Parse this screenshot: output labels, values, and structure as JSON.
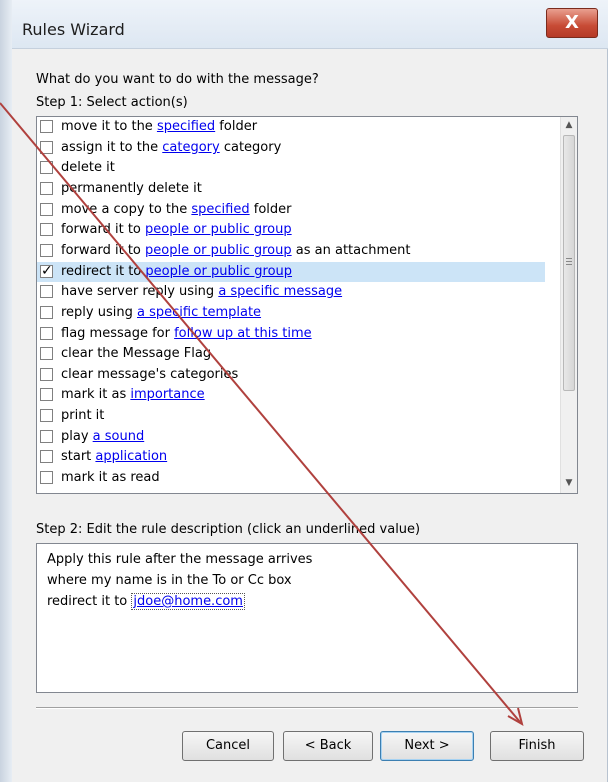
{
  "window": {
    "title": "Rules Wizard",
    "close_label": "X"
  },
  "prompt": "What do you want to do with the message?",
  "step1_label": "Step 1: Select action(s)",
  "actions": [
    {
      "checked": false,
      "parts": [
        {
          "t": "move it to the "
        },
        {
          "t": "specified",
          "link": true
        },
        {
          "t": " folder"
        }
      ]
    },
    {
      "checked": false,
      "parts": [
        {
          "t": "assign it to the "
        },
        {
          "t": "category",
          "link": true
        },
        {
          "t": " category"
        }
      ]
    },
    {
      "checked": false,
      "parts": [
        {
          "t": "delete it"
        }
      ]
    },
    {
      "checked": false,
      "parts": [
        {
          "t": "permanently delete it"
        }
      ]
    },
    {
      "checked": false,
      "parts": [
        {
          "t": "move a copy to the "
        },
        {
          "t": "specified",
          "link": true
        },
        {
          "t": " folder"
        }
      ]
    },
    {
      "checked": false,
      "parts": [
        {
          "t": "forward it to "
        },
        {
          "t": "people or public group",
          "link": true
        }
      ]
    },
    {
      "checked": false,
      "parts": [
        {
          "t": "forward it to "
        },
        {
          "t": "people or public group",
          "link": true
        },
        {
          "t": " as an attachment"
        }
      ]
    },
    {
      "checked": true,
      "selected": true,
      "parts": [
        {
          "t": "redirect it to "
        },
        {
          "t": "people or public group",
          "link": true
        }
      ]
    },
    {
      "checked": false,
      "parts": [
        {
          "t": "have server reply using "
        },
        {
          "t": "a specific message",
          "link": true
        }
      ]
    },
    {
      "checked": false,
      "parts": [
        {
          "t": "reply using "
        },
        {
          "t": "a specific template",
          "link": true
        }
      ]
    },
    {
      "checked": false,
      "parts": [
        {
          "t": "flag message for "
        },
        {
          "t": "follow up at this time",
          "link": true
        }
      ]
    },
    {
      "checked": false,
      "parts": [
        {
          "t": "clear the Message Flag"
        }
      ]
    },
    {
      "checked": false,
      "parts": [
        {
          "t": "clear message's categories"
        }
      ]
    },
    {
      "checked": false,
      "parts": [
        {
          "t": "mark it as "
        },
        {
          "t": "importance",
          "link": true
        }
      ]
    },
    {
      "checked": false,
      "parts": [
        {
          "t": "print it"
        }
      ]
    },
    {
      "checked": false,
      "parts": [
        {
          "t": "play "
        },
        {
          "t": "a sound",
          "link": true
        }
      ]
    },
    {
      "checked": false,
      "parts": [
        {
          "t": "start "
        },
        {
          "t": "application",
          "link": true
        }
      ]
    },
    {
      "checked": false,
      "parts": [
        {
          "t": "mark it as read"
        }
      ]
    }
  ],
  "step2_label": "Step 2: Edit the rule description (click an underlined value)",
  "description": {
    "line1": "Apply this rule after the message arrives",
    "line2": "where my name is in the To or Cc box",
    "line3_prefix": "redirect it to ",
    "line3_link": "jdoe@home.com"
  },
  "buttons": {
    "cancel": "Cancel",
    "back": "< Back",
    "next": "Next >",
    "finish": "Finish"
  },
  "annotation_color": "#b0413e"
}
